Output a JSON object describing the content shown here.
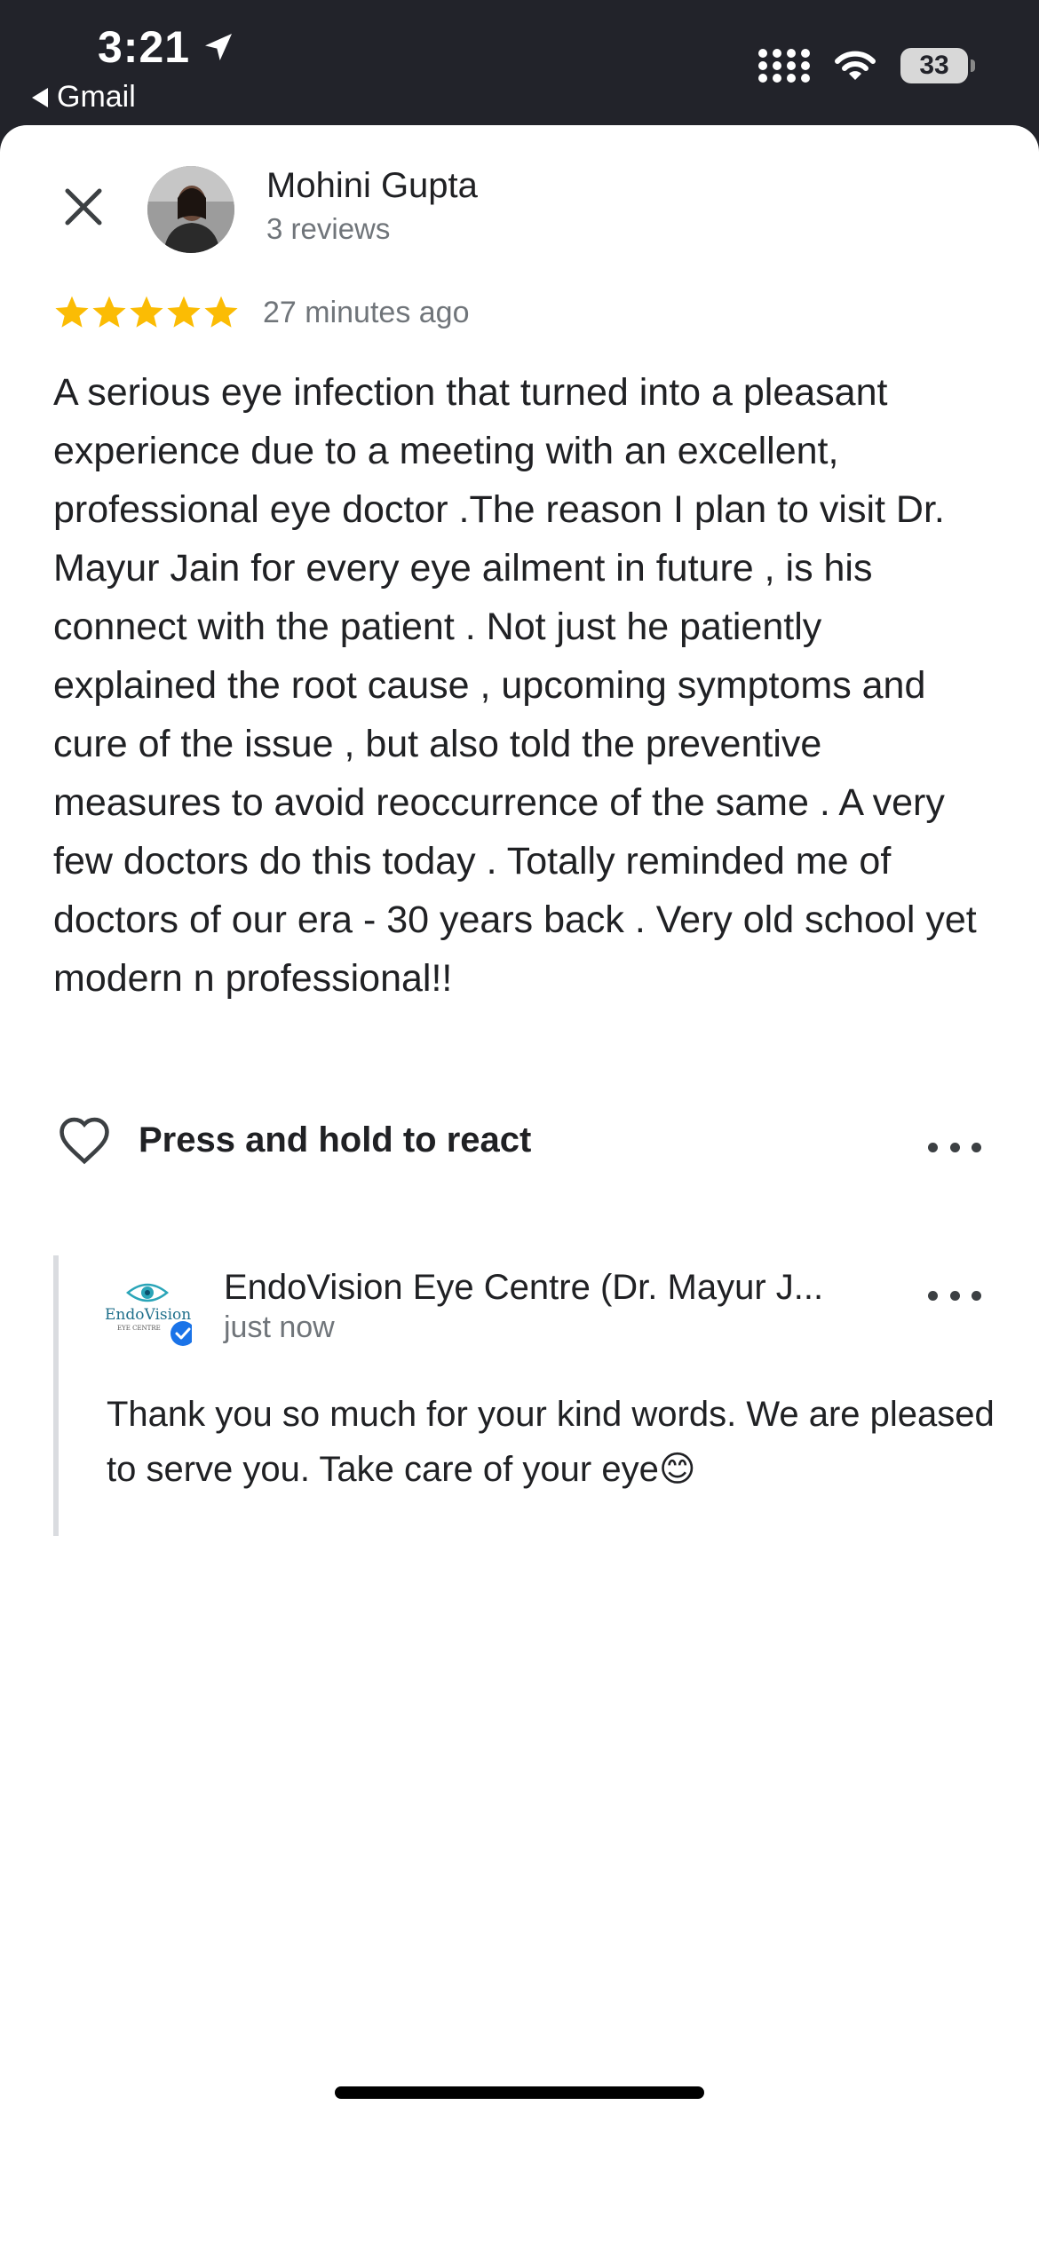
{
  "status_bar": {
    "time": "3:21",
    "back_app": "Gmail",
    "battery": "33"
  },
  "review": {
    "reviewer_name": "Mohini Gupta",
    "reviewer_reviews": "3 reviews",
    "rating": 5,
    "time_ago": "27 minutes ago",
    "text": "A serious eye infection that turned into a pleasant experience due to a meeting with an excellent, professional eye doctor .The reason I plan to visit Dr. Mayur Jain for every eye ailment in future , is his connect with the patient . Not just he patiently explained the root cause , upcoming symptoms and cure of the issue , but also told the preventive measures to avoid reoccurrence of the same . A very few doctors do this today . Totally reminded me of doctors of our era - 30 years back . Very old school yet modern n professional!!",
    "react_label": "Press and hold to react"
  },
  "reply": {
    "owner_name": "EndoVision Eye Centre (Dr. Mayur J...",
    "logo_text_1": "EndoVision",
    "logo_text_2": "EYE CENTRE",
    "time": "just now",
    "text": "Thank you so much for your kind words. We are pleased to serve you. Take care of your eye😊"
  },
  "colors": {
    "star": "#fbbc04",
    "verified": "#1a73e8",
    "status_bg": "#22232a"
  }
}
